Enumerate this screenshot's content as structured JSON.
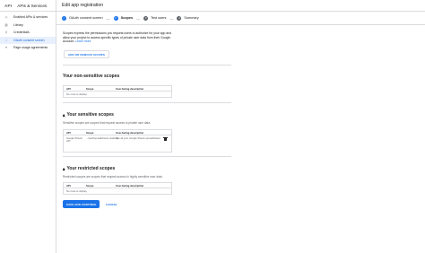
{
  "header": {
    "logo": "API",
    "app_title": "APIs & Services",
    "page_title": "Edit app registration"
  },
  "sidebar": {
    "items": [
      {
        "label": "Enabled APIs & services",
        "icon": "diamond-icon"
      },
      {
        "label": "Library",
        "icon": "library-icon"
      },
      {
        "label": "Credentials",
        "icon": "key-icon"
      },
      {
        "label": "OAuth consent screen",
        "icon": "consent-icon"
      },
      {
        "label": "Page usage agreements",
        "icon": "settings-list-icon"
      }
    ],
    "active_index": 3
  },
  "stepper": {
    "steps": [
      {
        "number": "✓",
        "label": "OAuth consent screen",
        "state": "done"
      },
      {
        "number": "2",
        "label": "Scopes",
        "state": "current"
      },
      {
        "number": "3",
        "label": "Test users",
        "state": "pending"
      },
      {
        "number": "4",
        "label": "Summary",
        "state": "pending"
      }
    ],
    "separator": "—"
  },
  "intro": {
    "text": "Scopes express the permissions you request users to authorize for your app and allow your project to access specific types of private user data from their Google Account.",
    "link": "Learn more"
  },
  "add_button_label": "ADD OR REMOVE SCOPES",
  "non_sensitive": {
    "title": "Your non-sensitive scopes",
    "columns": [
      "API",
      "Scope",
      "User-facing description"
    ],
    "empty": "No rows to display"
  },
  "sensitive": {
    "title": "Your sensitive scopes",
    "desc": "Sensitive scopes are scopes that request access to private user data.",
    "columns": [
      "API",
      "Scope",
      "User-facing description"
    ],
    "rows": [
      {
        "api": "Google Sheets API",
        "scope": ".../auth/spreadsheets.readonly",
        "desc": "See all your Google Sheets spreadsheets"
      }
    ]
  },
  "restricted": {
    "title": "Your restricted scopes",
    "desc": "Restricted scopes are scopes that request access to highly sensitive user data.",
    "columns": [
      "API",
      "Scope",
      "User-facing description"
    ],
    "empty": "No rows to display"
  },
  "actions": {
    "save": "SAVE AND CONTINUE",
    "cancel": "CANCEL"
  },
  "colors": {
    "accent": "#1a73e8",
    "active_bg": "#e8f0fe",
    "divider": "#dadce0"
  }
}
